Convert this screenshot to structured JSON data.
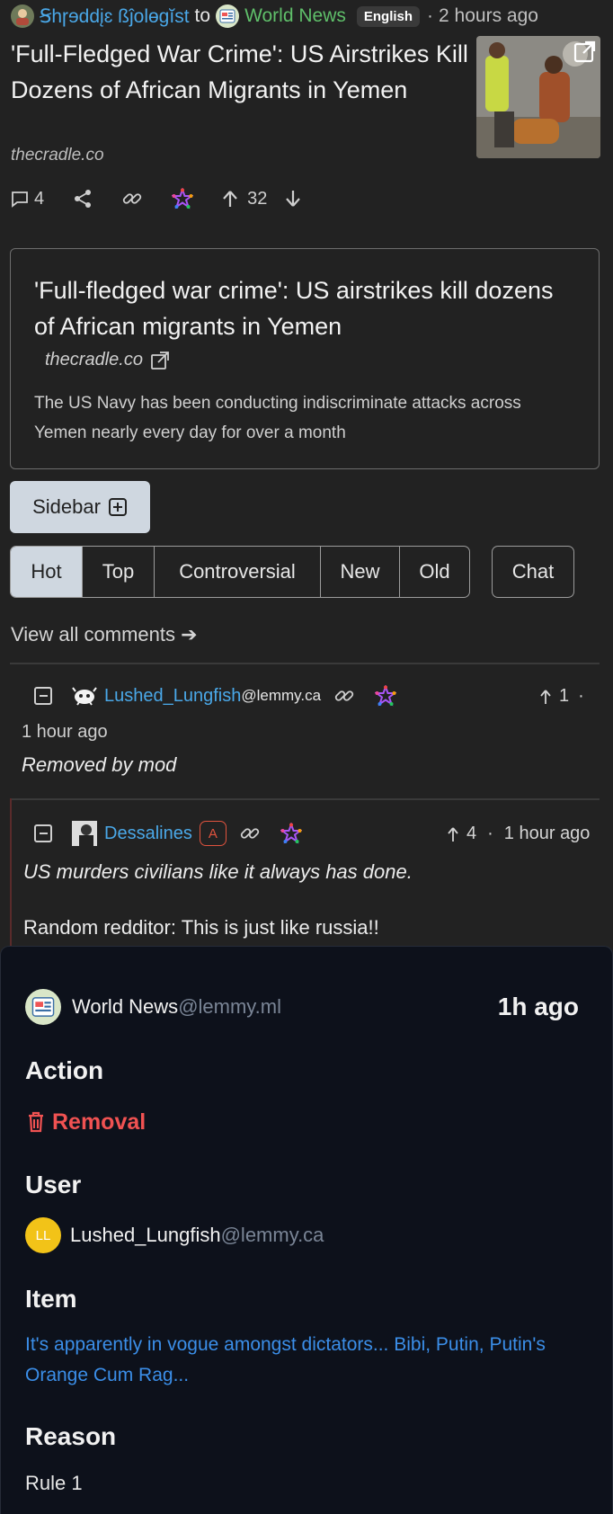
{
  "header": {
    "author": "Ꞩhɼɘddįɛ ßĵolɵgĭst",
    "to_text": "to",
    "community": "World News",
    "language": "English",
    "separator": "·",
    "time": "2 hours ago"
  },
  "post": {
    "title": "'Full-Fledged War Crime': US Airstrikes Kill Dozens of African Migrants in Yemen",
    "domain": "thecradle.co",
    "comment_count": "4",
    "score": "32"
  },
  "embed": {
    "title": "'Full-fledged war crime': US airstrikes kill dozens of African migrants in Yemen",
    "domain": "thecradle.co",
    "description": "The US Navy has been conducting indiscriminate attacks across Yemen nearly every day for over a month"
  },
  "sidebar_button": "Sidebar",
  "sort_tabs": [
    "Hot",
    "Top",
    "Controversial",
    "New",
    "Old"
  ],
  "active_sort": "Hot",
  "chat_button": "Chat",
  "view_all": "View all comments ➔",
  "comments": [
    {
      "user": "Lushed_Lungfish",
      "instance": "@lemmy.ca",
      "score": "1",
      "dot": "·",
      "time": "1 hour ago",
      "body": "Removed by mod"
    },
    {
      "user": "Dessalines",
      "badge": "A",
      "score": "4",
      "dot": "·",
      "time": "1 hour ago",
      "body_line1": "US murders civilians like it always has done.",
      "body_line2": "Random redditor: This is just like russia!!"
    }
  ],
  "modlog": {
    "community": "World News",
    "community_instance": "@lemmy.ml",
    "time": "1h ago",
    "action_heading": "Action",
    "action": "Removal",
    "user_heading": "User",
    "user_initials": "LL",
    "user": "Lushed_Lungfish",
    "user_instance": "@lemmy.ca",
    "item_heading": "Item",
    "item": "It's apparently in vogue amongst dictators... Bibi, Putin, Putin's Orange Cum Rag...",
    "reason_heading": "Reason",
    "reason": "Rule 1"
  },
  "colors": {
    "background": "#222222",
    "link": "#4aa8e8",
    "panel": "#0d111b",
    "removal": "#f05252",
    "admin_badge": "#e0533e",
    "avatar_yellow": "#f2c318",
    "active_tab": "#cfd7e0"
  },
  "icons": [
    "user-avatar-icon",
    "world-news-icon",
    "external-link-icon",
    "comment-icon",
    "share-icon",
    "link-icon",
    "fediverse-star-icon",
    "upvote-icon",
    "downvote-icon",
    "plus-box-icon",
    "collapse-icon",
    "trash-icon"
  ]
}
